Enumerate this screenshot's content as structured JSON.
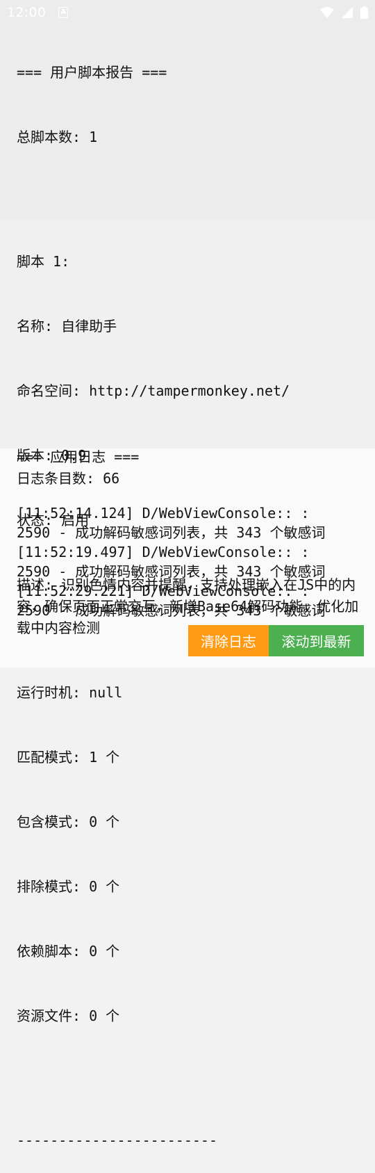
{
  "status_bar": {
    "time": "12:00",
    "notification_icon": "A",
    "icons": [
      "wifi-icon",
      "signal-icon",
      "battery-icon"
    ]
  },
  "script_report": {
    "heading": "=== 用户脚本报告 ===",
    "total_line": "总脚本数: 1",
    "script_title": "脚本 1:",
    "name_line": "名称: 自律助手",
    "namespace_line": "命名空间: http://tampermonkey.net/",
    "version_line": "版本: 0.9",
    "status_line": "状态: 启用",
    "description_line": "描述: 识别色情内容并提醒，支持处理嵌入在JS中的内容，确保页面正常交互，新增Base64解码功能，优化加载中内容检测",
    "run_at_line": "运行时机: null",
    "match_line": "匹配模式: 1 个",
    "include_line": "包含模式: 0 个",
    "exclude_line": "排除模式: 0 个",
    "require_line": "依赖脚本: 0 个",
    "resource_line": "资源文件: 0 个",
    "separator": "------------------------"
  },
  "app_log": {
    "heading": "=== 应用日志 ===",
    "count_line": "日志条目数: 66",
    "entries": [
      {
        "line1": "[11:52:14.124] D/WebViewConsole:: :",
        "line2": "2590 - 成功解码敏感词列表，共 343 个敏感词"
      },
      {
        "line1": "[11:52:19.497] D/WebViewConsole:: :",
        "line2": "2590 - 成功解码敏感词列表，共 343 个敏感词"
      },
      {
        "line1": "[11:52:29.221] D/WebViewConsole:: :",
        "line2": "2590 - 成功解码敏感词列表，共 343 个敏感词"
      }
    ]
  },
  "buttons": {
    "clear_label": "清除日志",
    "scroll_label": "滚动到最新",
    "clear_color": "#ff9b14",
    "scroll_color": "#4caf50"
  }
}
